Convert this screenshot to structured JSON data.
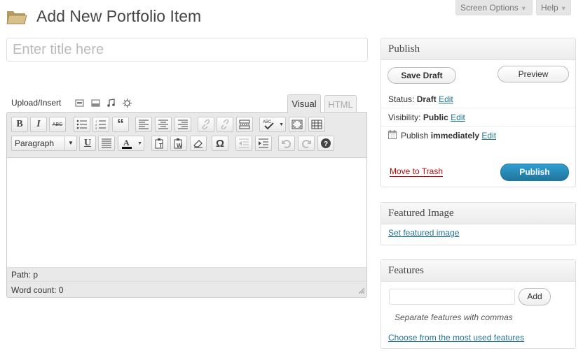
{
  "header": {
    "page_title": "Add New Portfolio Item",
    "screen_options": "Screen Options",
    "help": "Help"
  },
  "title_field": {
    "placeholder": "Enter title here"
  },
  "media": {
    "label": "Upload/Insert"
  },
  "editor_tabs": {
    "visual": "Visual",
    "html": "HTML"
  },
  "toolbar": {
    "format_select": "Paragraph",
    "bold": "B",
    "italic": "I",
    "strike": "ABC",
    "quote": "“",
    "omega": "Ω",
    "underline": "U"
  },
  "editor_status": {
    "path": "Path: p",
    "word_count": "Word count: 0"
  },
  "publish": {
    "title": "Publish",
    "save_draft": "Save Draft",
    "preview": "Preview",
    "status_label": "Status:",
    "status_value": "Draft",
    "visibility_label": "Visibility:",
    "visibility_value": "Public",
    "schedule_label": "Publish",
    "schedule_value": "immediately",
    "edit": "Edit",
    "trash": "Move to Trash",
    "publish_button": "Publish"
  },
  "featured_image": {
    "title": "Featured Image",
    "link": "Set featured image"
  },
  "features": {
    "title": "Features",
    "add_button": "Add",
    "hint": "Separate features with commas",
    "choose_link": "Choose from the most used features"
  },
  "colors": {
    "accent": "#21759b",
    "publish_button": "#2a8cbb",
    "trash": "#bc0b0b"
  }
}
